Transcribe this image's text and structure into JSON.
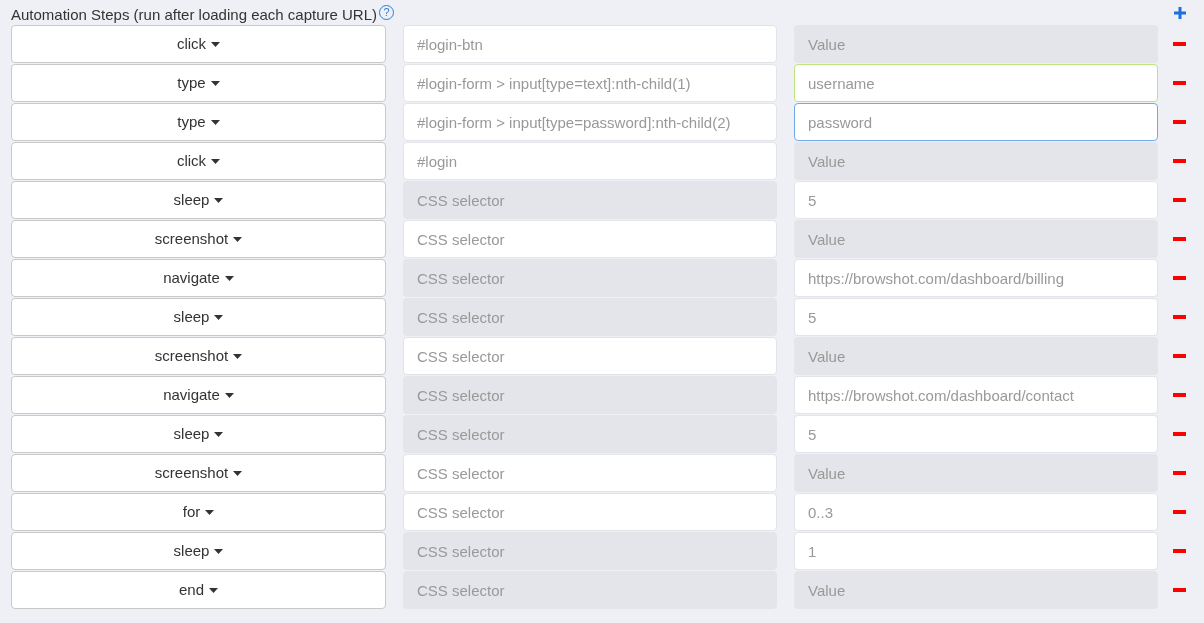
{
  "header": {
    "title": "Automation Steps (run after loading each capture URL)",
    "help_icon": "?"
  },
  "steps": [
    {
      "action": "click",
      "selector": {
        "value": "#login-btn",
        "disabled": false
      },
      "value": {
        "placeholder": "Value",
        "disabled": true,
        "valid": false,
        "focused": false
      }
    },
    {
      "action": "type",
      "selector": {
        "value": "#login-form > input[type=text]:nth-child(1)",
        "disabled": false
      },
      "value": {
        "value": "username",
        "disabled": false,
        "valid": true,
        "focused": false
      }
    },
    {
      "action": "type",
      "selector": {
        "value": "#login-form > input[type=password]:nth-child(2)",
        "disabled": false
      },
      "value": {
        "value": "password",
        "disabled": false,
        "valid": false,
        "focused": true
      }
    },
    {
      "action": "click",
      "selector": {
        "value": "#login",
        "disabled": false
      },
      "value": {
        "placeholder": "Value",
        "disabled": true,
        "valid": false,
        "focused": false
      }
    },
    {
      "action": "sleep",
      "selector": {
        "placeholder": "CSS selector",
        "disabled": true
      },
      "value": {
        "value": "5",
        "disabled": false,
        "valid": false,
        "focused": false
      }
    },
    {
      "action": "screenshot",
      "selector": {
        "placeholder": "CSS selector",
        "disabled": false
      },
      "value": {
        "placeholder": "Value",
        "disabled": true,
        "valid": false,
        "focused": false
      }
    },
    {
      "action": "navigate",
      "selector": {
        "placeholder": "CSS selector",
        "disabled": true
      },
      "value": {
        "value": "https://browshot.com/dashboard/billing",
        "disabled": false,
        "valid": false,
        "focused": false
      }
    },
    {
      "action": "sleep",
      "selector": {
        "placeholder": "CSS selector",
        "disabled": true
      },
      "value": {
        "value": "5",
        "disabled": false,
        "valid": false,
        "focused": false
      }
    },
    {
      "action": "screenshot",
      "selector": {
        "placeholder": "CSS selector",
        "disabled": false
      },
      "value": {
        "placeholder": "Value",
        "disabled": true,
        "valid": false,
        "focused": false
      }
    },
    {
      "action": "navigate",
      "selector": {
        "placeholder": "CSS selector",
        "disabled": true
      },
      "value": {
        "value": "https://browshot.com/dashboard/contact",
        "disabled": false,
        "valid": false,
        "focused": false
      }
    },
    {
      "action": "sleep",
      "selector": {
        "placeholder": "CSS selector",
        "disabled": true
      },
      "value": {
        "value": "5",
        "disabled": false,
        "valid": false,
        "focused": false
      }
    },
    {
      "action": "screenshot",
      "selector": {
        "placeholder": "CSS selector",
        "disabled": false
      },
      "value": {
        "placeholder": "Value",
        "disabled": true,
        "valid": false,
        "focused": false
      }
    },
    {
      "action": "for",
      "selector": {
        "placeholder": "CSS selector",
        "disabled": false
      },
      "value": {
        "value": "0..3",
        "disabled": false,
        "valid": false,
        "focused": false
      }
    },
    {
      "action": "sleep",
      "selector": {
        "placeholder": "CSS selector",
        "disabled": true
      },
      "value": {
        "value": "1",
        "disabled": false,
        "valid": false,
        "focused": false
      }
    },
    {
      "action": "end",
      "selector": {
        "placeholder": "CSS selector",
        "disabled": true
      },
      "value": {
        "placeholder": "Value",
        "disabled": true,
        "valid": false,
        "focused": false
      }
    }
  ]
}
